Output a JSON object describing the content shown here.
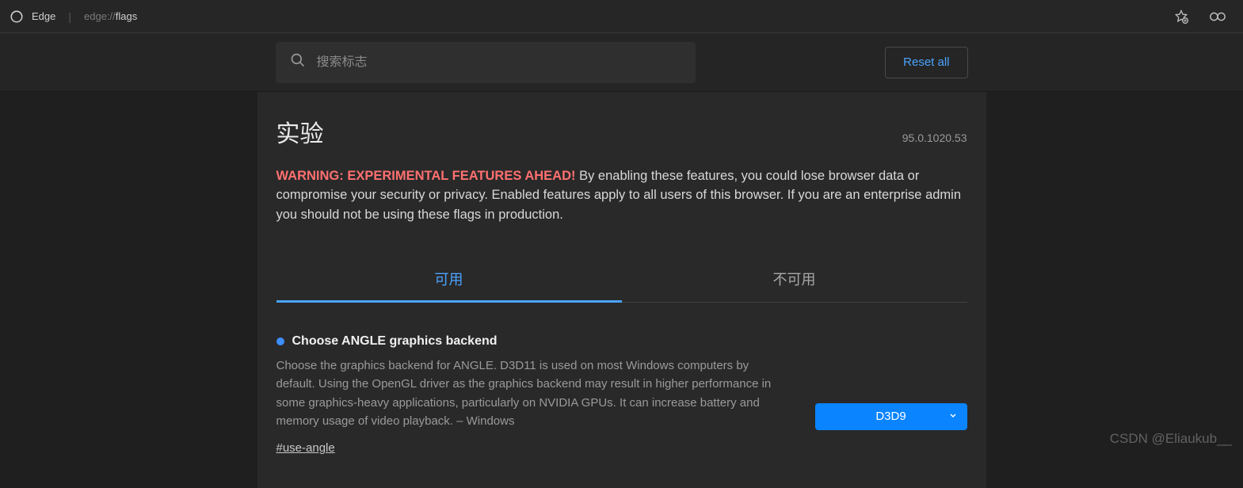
{
  "titlebar": {
    "app_name": "Edge",
    "url_prefix": "edge://",
    "url_path": "flags"
  },
  "toolbar": {
    "search_placeholder": "搜索标志",
    "reset_label": "Reset all"
  },
  "header": {
    "title": "实验",
    "version": "95.0.1020.53"
  },
  "warning": {
    "prefix": "WARNING: EXPERIMENTAL FEATURES AHEAD!",
    "body": " By enabling these features, you could lose browser data or compromise your security or privacy. Enabled features apply to all users of this browser. If you are an enterprise admin you should not be using these flags in production."
  },
  "tabs": {
    "available": "可用",
    "unavailable": "不可用"
  },
  "flag": {
    "title": "Choose ANGLE graphics backend",
    "description": "Choose the graphics backend for ANGLE. D3D11 is used on most Windows computers by default. Using the OpenGL driver as the graphics backend may result in higher performance in some graphics-heavy applications, particularly on NVIDIA GPUs. It can increase battery and memory usage of video playback. – Windows",
    "anchor": "#use-angle",
    "selected": "D3D9"
  },
  "watermark": "CSDN @Eliaukub__"
}
